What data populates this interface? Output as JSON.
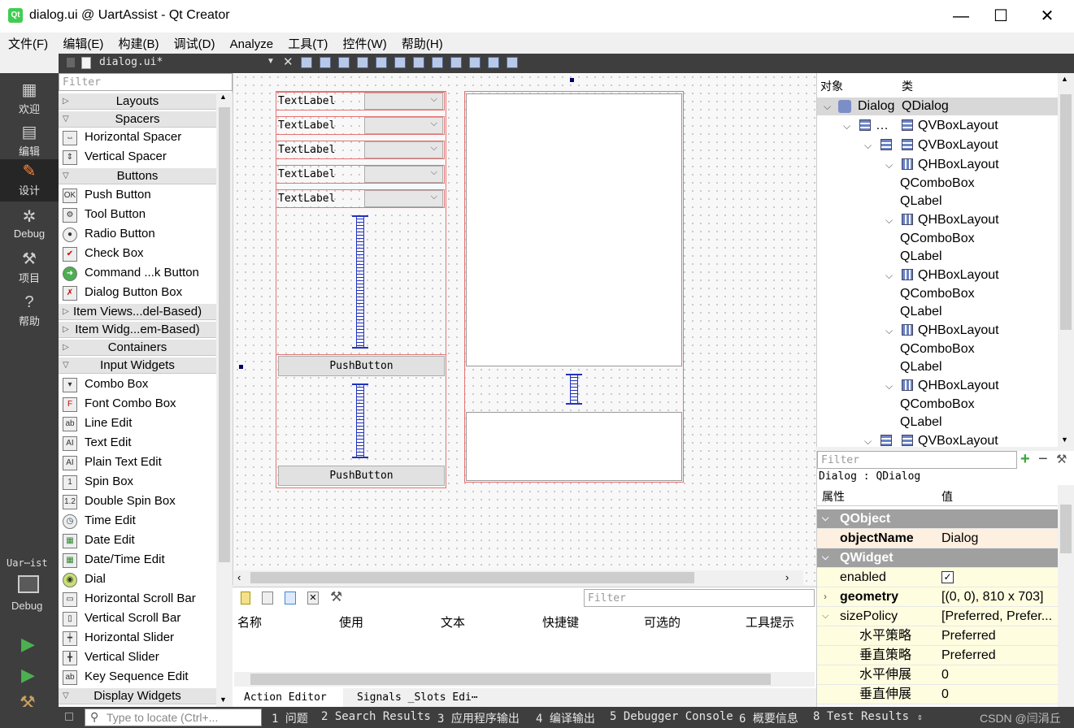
{
  "window": {
    "title": "dialog.ui @ UartAssist - Qt Creator",
    "qt_logo": "Qt",
    "minimize": "—",
    "maximize": "☐",
    "close": "✕"
  },
  "menu": [
    "文件(F)",
    "编辑(E)",
    "构建(B)",
    "调试(D)",
    "Analyze",
    "工具(T)",
    "控件(W)",
    "帮助(H)"
  ],
  "editor": {
    "filename": "dialog.ui*"
  },
  "modes": [
    {
      "label": "欢迎",
      "icon": "grid-icon"
    },
    {
      "label": "编辑",
      "icon": "document-icon"
    },
    {
      "label": "设计",
      "icon": "pencil-icon"
    },
    {
      "label": "Debug",
      "icon": "bug-icon"
    },
    {
      "label": "项目",
      "icon": "wrench-icon"
    },
    {
      "label": "帮助",
      "icon": "help-icon"
    }
  ],
  "kit": {
    "project": "Uar⋯ist",
    "config": "Debug"
  },
  "widgetbox": {
    "filter_placeholder": "Filter",
    "categories": {
      "layouts": "Layouts",
      "spacers": "Spacers",
      "buttons": "Buttons",
      "itemviews": "Item Views...del-Based)",
      "itemwidgets": "Item Widg...em-Based)",
      "containers": "Containers",
      "inputwidgets": "Input Widgets",
      "displaywidgets": "Display Widgets"
    },
    "spacers": [
      "Horizontal Spacer",
      "Vertical Spacer"
    ],
    "buttons": [
      "Push Button",
      "Tool Button",
      "Radio Button",
      "Check Box",
      "Command ...k Button",
      "Dialog Button Box"
    ],
    "inputs": [
      "Combo Box",
      "Font Combo Box",
      "Line Edit",
      "Text Edit",
      "Plain Text Edit",
      "Spin Box",
      "Double Spin Box",
      "Time Edit",
      "Date Edit",
      "Date/Time Edit",
      "Dial",
      "Horizontal Scroll Bar",
      "Vertical Scroll Bar",
      "Horizontal Slider",
      "Vertical Slider",
      "Key Sequence Edit"
    ]
  },
  "form": {
    "labels": [
      "TextLabel",
      "TextLabel",
      "TextLabel",
      "TextLabel",
      "TextLabel"
    ],
    "button1": "PushButton",
    "button2": "PushButton"
  },
  "action_editor": {
    "filter_placeholder": "Filter",
    "columns": [
      "名称",
      "使用",
      "文本",
      "快捷键",
      "可选的",
      "工具提示"
    ],
    "tabs": [
      "Action Editor",
      "Signals _Slots Edi⋯"
    ]
  },
  "object_inspector": {
    "col_object": "对象",
    "col_class": "类",
    "rows": [
      {
        "obj": "Dialog",
        "cls": "QDialog"
      },
      {
        "obj": "…",
        "cls": "QVBoxLayout"
      },
      {
        "obj": "",
        "cls": "QVBoxLayout"
      },
      {
        "obj": "",
        "cls": "QHBoxLayout"
      },
      {
        "obj": "",
        "cls": "QComboBox"
      },
      {
        "obj": "",
        "cls": "QLabel"
      },
      {
        "obj": "",
        "cls": "QHBoxLayout"
      },
      {
        "obj": "",
        "cls": "QComboBox"
      },
      {
        "obj": "",
        "cls": "QLabel"
      },
      {
        "obj": "",
        "cls": "QHBoxLayout"
      },
      {
        "obj": "",
        "cls": "QComboBox"
      },
      {
        "obj": "",
        "cls": "QLabel"
      },
      {
        "obj": "",
        "cls": "QHBoxLayout"
      },
      {
        "obj": "",
        "cls": "QComboBox"
      },
      {
        "obj": "",
        "cls": "QLabel"
      },
      {
        "obj": "",
        "cls": "QHBoxLayout"
      },
      {
        "obj": "",
        "cls": "QComboBox"
      },
      {
        "obj": "",
        "cls": "QLabel"
      },
      {
        "obj": "",
        "cls": "QVBoxLayout"
      }
    ]
  },
  "property_editor": {
    "filter_placeholder": "Filter",
    "context": "Dialog : QDialog",
    "col_prop": "属性",
    "col_value": "值",
    "rows": [
      {
        "name": "QObject",
        "value": ""
      },
      {
        "name": "objectName",
        "value": "Dialog"
      },
      {
        "name": "QWidget",
        "value": ""
      },
      {
        "name": "enabled",
        "value": "✓"
      },
      {
        "name": "geometry",
        "value": "[(0, 0), 810 x 703]"
      },
      {
        "name": "sizePolicy",
        "value": "[Preferred, Prefer..."
      },
      {
        "name": "水平策略",
        "value": "Preferred"
      },
      {
        "name": "垂直策略",
        "value": "Preferred"
      },
      {
        "name": "水平伸展",
        "value": "0"
      },
      {
        "name": "垂直伸展",
        "value": "0"
      }
    ]
  },
  "statusbar": {
    "locate_placeholder": "Type to locate (Ctrl+...",
    "items": [
      "1 问题",
      "2 Search Results",
      "3 应用程序输出",
      "4 编译输出",
      "5 Debugger Console",
      "6 概要信息",
      "8 Test Results"
    ],
    "watermark": "CSDN @闫涓丘"
  }
}
